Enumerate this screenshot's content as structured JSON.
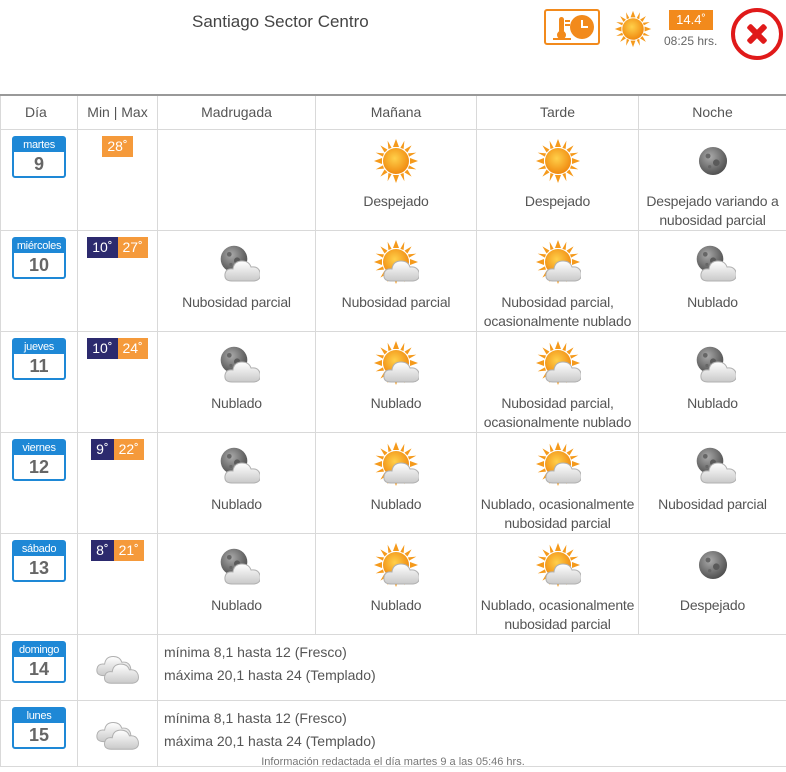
{
  "header": {
    "station": "Santiago Sector Centro",
    "current_temp": "14.4˚",
    "current_time": "08:25 hrs."
  },
  "columns": {
    "day": "Día",
    "minmax": "Min | Max",
    "madrugada": "Madrugada",
    "manana": "Mañana",
    "tarde": "Tarde",
    "noche": "Noche"
  },
  "days": [
    {
      "name": "martes",
      "date": "9",
      "min": "",
      "max": "28˚",
      "slots": [
        {
          "icon": "none",
          "text": ""
        },
        {
          "icon": "sun-icon",
          "text": "Despejado"
        },
        {
          "icon": "sun-icon",
          "text": "Despejado"
        },
        {
          "icon": "moon-icon",
          "text": "Despejado variando a nubosidad parcial"
        }
      ]
    },
    {
      "name": "miércoles",
      "date": "10",
      "min": "10˚",
      "max": "27˚",
      "slots": [
        {
          "icon": "moon-cloud-icon",
          "text": "Nubosidad parcial"
        },
        {
          "icon": "sun-cloud-icon",
          "text": "Nubosidad parcial"
        },
        {
          "icon": "sun-cloud-icon",
          "text": "Nubosidad parcial, ocasionalmente nublado"
        },
        {
          "icon": "moon-cloud-icon",
          "text": "Nublado"
        }
      ]
    },
    {
      "name": "jueves",
      "date": "11",
      "min": "10˚",
      "max": "24˚",
      "slots": [
        {
          "icon": "moon-cloud-icon",
          "text": "Nublado"
        },
        {
          "icon": "sun-cloud-icon",
          "text": "Nublado"
        },
        {
          "icon": "sun-cloud-icon",
          "text": "Nubosidad parcial, ocasionalmente nublado"
        },
        {
          "icon": "moon-cloud-icon",
          "text": "Nublado"
        }
      ]
    },
    {
      "name": "viernes",
      "date": "12",
      "min": "9˚",
      "max": "22˚",
      "slots": [
        {
          "icon": "moon-cloud-icon",
          "text": "Nublado"
        },
        {
          "icon": "sun-cloud-icon",
          "text": "Nublado"
        },
        {
          "icon": "sun-cloud-icon",
          "text": "Nublado, ocasionalmente nubosidad parcial"
        },
        {
          "icon": "moon-cloud-icon",
          "text": "Nubosidad parcial"
        }
      ]
    },
    {
      "name": "sábado",
      "date": "13",
      "min": "8˚",
      "max": "21˚",
      "slots": [
        {
          "icon": "moon-cloud-icon",
          "text": "Nublado"
        },
        {
          "icon": "sun-cloud-icon",
          "text": "Nublado"
        },
        {
          "icon": "sun-cloud-icon",
          "text": "Nublado, ocasionalmente nubosidad parcial"
        },
        {
          "icon": "moon-icon",
          "text": "Despejado"
        }
      ]
    }
  ],
  "extended": [
    {
      "name": "domingo",
      "date": "14",
      "icon": "cloudy-icon",
      "line1": "mínima 8,1 hasta 12 (Fresco)",
      "line2": "máxima 20,1 hasta 24 (Templado)"
    },
    {
      "name": "lunes",
      "date": "15",
      "icon": "cloudy-icon",
      "line1": "mínima 8,1 hasta 12 (Fresco)",
      "line2": "máxima 20,1 hasta 24 (Templado)"
    }
  ],
  "footer": "Información redactada el día martes 9 a las 05:46 hrs.",
  "colors": {
    "accent": "#f28a1c",
    "day_header": "#1e88d6",
    "min_bg": "#2c2a6e",
    "max_bg": "#f59a3b",
    "close": "#e01a1a"
  }
}
